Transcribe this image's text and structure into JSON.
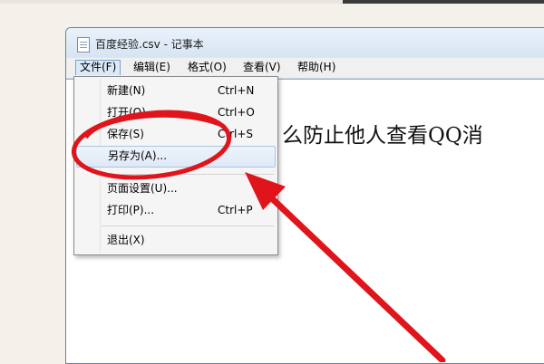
{
  "window": {
    "title": "百度经验.csv - 记事本"
  },
  "menubar": {
    "items": [
      "文件(F)",
      "编辑(E)",
      "格式(O)",
      "查看(V)",
      "帮助(H)"
    ]
  },
  "file_menu": {
    "items": [
      {
        "label": "新建(N)",
        "shortcut": "Ctrl+N"
      },
      {
        "label": "打开(O)",
        "shortcut": "Ctrl+O"
      },
      {
        "label": "保存(S)",
        "shortcut": "Ctrl+S"
      },
      {
        "label": "另存为(A)...",
        "shortcut": ""
      },
      {
        "label": "页面设置(U)...",
        "shortcut": ""
      },
      {
        "label": "打印(P)...",
        "shortcut": "Ctrl+P"
      },
      {
        "label": "退出(X)",
        "shortcut": ""
      }
    ]
  },
  "document": {
    "text": "么防止他人查看QQ消"
  },
  "annotation": {
    "color": "#e0141b"
  }
}
